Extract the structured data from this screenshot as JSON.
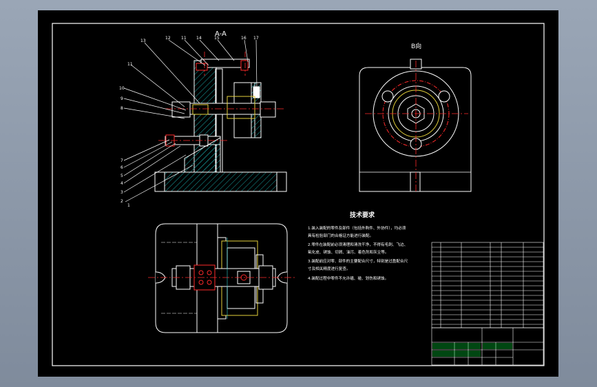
{
  "views": {
    "section_label": "A-A",
    "direction_label": "B向"
  },
  "tech": {
    "title": "技术要求",
    "lines": [
      "1.装入装配的零件及部件（包括外购件、外协件），均必须",
      "具有检验部门的合格证方能进行装配。",
      "2.零件在装配前必须清理和清洗干净，不得有毛刺、飞边、",
      "氧化皮、锈蚀、切屑、油污、着色剂和灰尘等。",
      "3.装配前应对零、部件的主要配合尺寸，特别是过盈配合尺",
      "寸及相关精度进行复查。",
      "4.装配过程中零件不允许磕、碰、划伤和锈蚀。"
    ]
  },
  "leaders": {
    "top": [
      "13",
      "12",
      "11",
      "14",
      "15",
      "16",
      "17"
    ],
    "left": [
      "11",
      "10",
      "9",
      "8",
      "7",
      "6",
      "5",
      "4",
      "3",
      "2",
      "1"
    ]
  },
  "colors": {
    "bg": "#000000",
    "line": "#ffffff",
    "red": "#ff2a2a",
    "yellow": "#e6d23c",
    "cyan": "#2fd0d0",
    "green": "#22c55e",
    "hatch": "#18a8a8"
  }
}
